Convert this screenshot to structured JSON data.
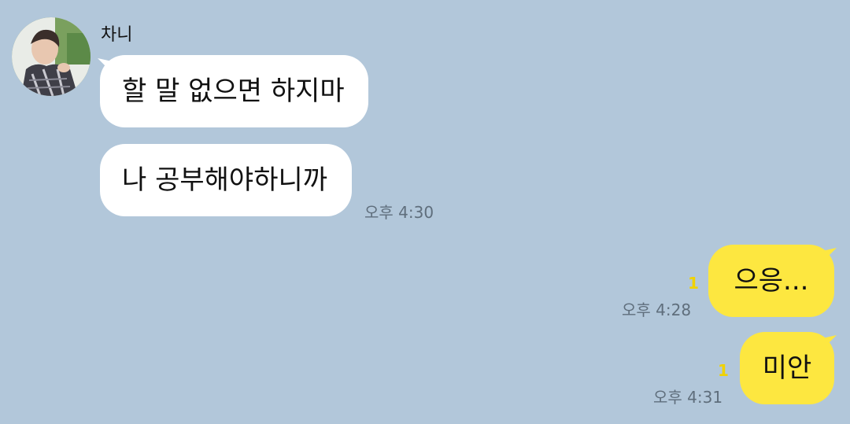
{
  "sender": {
    "name": "차니",
    "avatar": "profile-photo"
  },
  "incoming": [
    {
      "text": "할 말 없으면 하지마"
    },
    {
      "text": "나 공부해야하니까",
      "time": "오후 4:30"
    }
  ],
  "outgoing": [
    {
      "text": "으응...",
      "time": "오후 4:28",
      "unread": "1"
    },
    {
      "text": "미안",
      "time": "오후 4:31",
      "unread": "1"
    }
  ],
  "colors": {
    "background": "#b2c7da",
    "incoming_bubble": "#ffffff",
    "outgoing_bubble": "#fde740",
    "unread": "#f0d200",
    "time": "#5f6e7c"
  }
}
